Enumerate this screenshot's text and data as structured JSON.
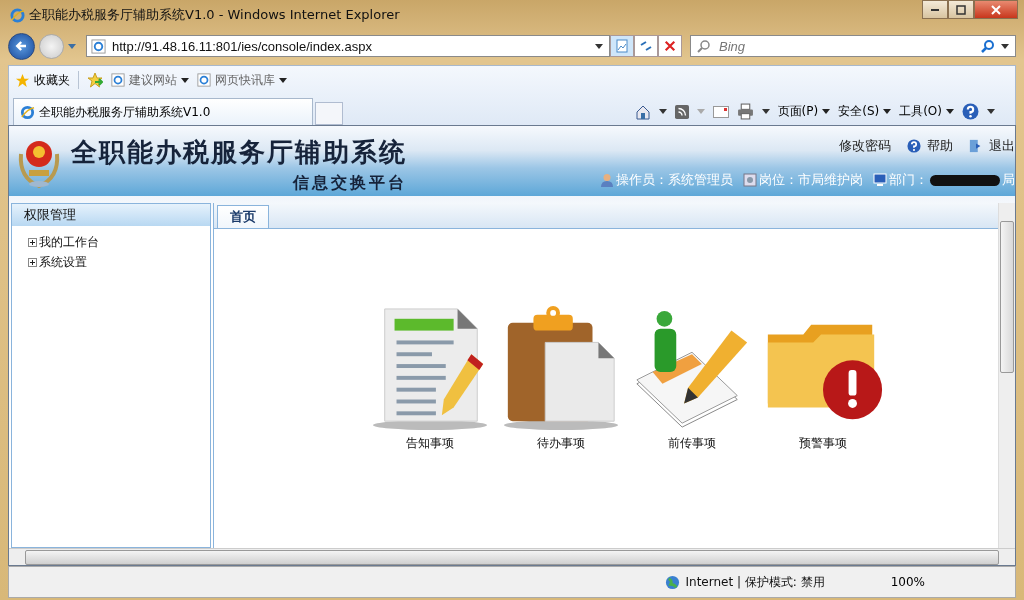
{
  "window": {
    "title": "全职能办税服务厅辅助系统V1.0 - Windows Internet Explorer"
  },
  "address_bar": {
    "url": "http://91.48.16.11:801/ies/console/index.aspx"
  },
  "search": {
    "placeholder": "Bing"
  },
  "favorites_bar": {
    "favorites": "收藏夹",
    "links": [
      "建议网站",
      "网页快讯库"
    ]
  },
  "browser_tabs": [
    {
      "label": "全职能办税服务厅辅助系统V1.0",
      "selected": true
    }
  ],
  "command_bar": [
    "页面(P)",
    "安全(S)",
    "工具(O)"
  ],
  "app_header": {
    "title": "全职能办税服务厅辅助系统",
    "subtitle": "信息交换平台",
    "links": [
      {
        "kind": "text",
        "label": "修改密码"
      },
      {
        "kind": "help",
        "label": "帮助"
      },
      {
        "kind": "exit",
        "label": "退出"
      }
    ],
    "user_info": [
      {
        "kind": "user",
        "label": "操作员：系统管理员"
      },
      {
        "kind": "post",
        "label": "岗位：市局维护岗"
      },
      {
        "kind": "dept",
        "label": "部门：",
        "value": "局"
      }
    ]
  },
  "sidebar": {
    "title": "权限管理",
    "items": [
      {
        "label": "我的工作台",
        "expanded": false
      },
      {
        "label": "系统设置",
        "expanded": false
      }
    ]
  },
  "content_tabs": [
    {
      "label": "首页",
      "selected": true
    }
  ],
  "shortcuts": [
    {
      "kind": "notice",
      "label": "告知事项"
    },
    {
      "kind": "todo",
      "label": "待办事项"
    },
    {
      "kind": "forward",
      "label": "前传事项"
    },
    {
      "kind": "warning",
      "label": "预警事项"
    }
  ],
  "status_bar": {
    "zone": "Internet | 保护模式: 禁用",
    "zoom": "100%"
  }
}
